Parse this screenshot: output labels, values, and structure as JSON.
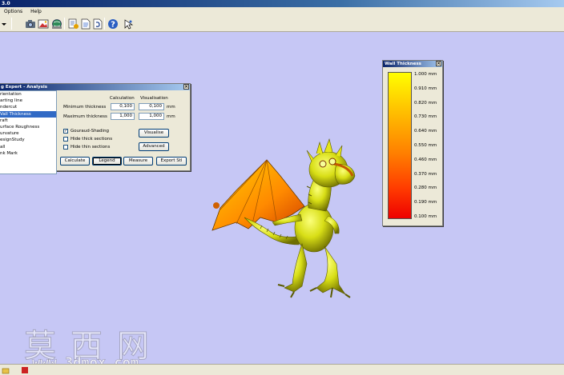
{
  "window": {
    "title": "3.0"
  },
  "menu": {
    "items": [
      "Options",
      "Help"
    ]
  },
  "toolbar": {
    "icons": [
      "dropdown-arrow-icon",
      "camera-icon",
      "image-icon",
      "globe-icon",
      "analysis-icon",
      "document-icon",
      "undo-icon",
      "help-icon",
      "pointer-icon"
    ]
  },
  "analysis_panel": {
    "title": "g Expert - Analysis",
    "list": [
      "rientation",
      "arting line",
      "ndercut",
      "Vall Thickness",
      "raft",
      "urface Roughness",
      "urvature",
      "esignStudy",
      "all",
      "nk Mark"
    ],
    "selected_index": 3,
    "col_calc": "Calculation",
    "col_vis": "Visualisation",
    "min_label": "Minimum thickness",
    "max_label": "Maximum thickness",
    "min_calc": "0,100",
    "min_vis": "0,100",
    "max_calc": "1,000",
    "max_vis": "1,000",
    "unit": "mm",
    "options": [
      {
        "label": "Gouraud-Shading",
        "checked": true,
        "mark": "✓"
      },
      {
        "label": "Hide thick sections",
        "checked": false,
        "mark": ""
      },
      {
        "label": "Hide thin sections",
        "checked": false,
        "mark": ""
      }
    ],
    "visualise_btn": "Visualise",
    "advanced_btn": "Advanced",
    "buttons": [
      "Calculate",
      "Legend",
      "Measure",
      "Export Stl"
    ]
  },
  "legend_panel": {
    "title": "Wall Thickness",
    "scale": [
      "1.000 mm",
      "0.910 mm",
      "0.820 mm",
      "0.730 mm",
      "0.640 mm",
      "0.550 mm",
      "0.460 mm",
      "0.370 mm",
      "0.280 mm",
      "0.190 mm",
      "0.100 mm"
    ],
    "colors": {
      "top": "#ffff00",
      "bottom": "#ee0000"
    }
  },
  "watermark": {
    "chars": "莫西网",
    "url": "www.3dmox.com"
  }
}
